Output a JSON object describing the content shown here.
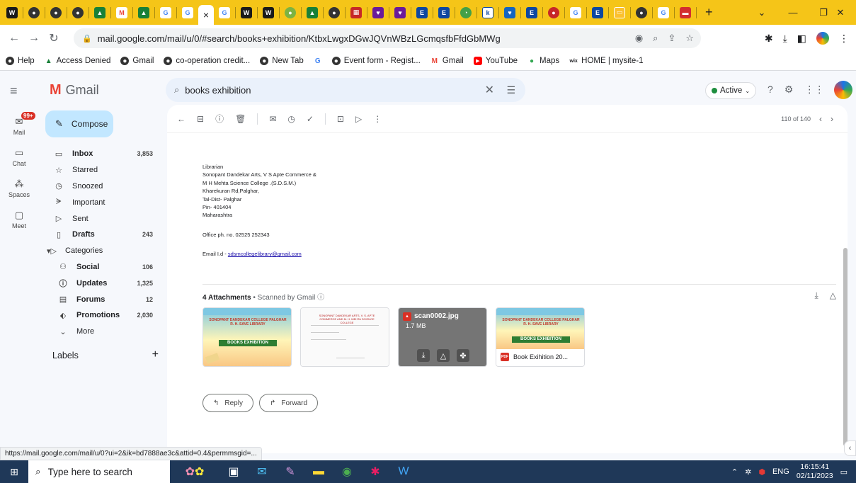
{
  "browser": {
    "active_tab_close": "×",
    "new_tab": "+",
    "url": "mail.google.com/mail/u/0/#search/books+exhibition/KtbxLwgxDGwJQVnWBzLGcmqsfbFfdGbMWg",
    "window_controls": [
      "⌄",
      "—",
      "❐",
      "✕"
    ]
  },
  "bookmarks": [
    {
      "label": "Help"
    },
    {
      "label": "Access Denied"
    },
    {
      "label": "Gmail"
    },
    {
      "label": "co-operation credit..."
    },
    {
      "label": "New Tab"
    },
    {
      "label": "Event form - Regist..."
    },
    {
      "label": "Gmail"
    },
    {
      "label": "YouTube"
    },
    {
      "label": "Maps"
    },
    {
      "label": "HOME | mysite-1"
    }
  ],
  "gmail": {
    "logo_text": "Gmail",
    "search_value": "books exhibition",
    "status": "Active",
    "rail": [
      {
        "label": "Mail",
        "badge": "99+"
      },
      {
        "label": "Chat"
      },
      {
        "label": "Spaces"
      },
      {
        "label": "Meet"
      }
    ],
    "compose_label": "Compose",
    "nav": [
      {
        "label": "Inbox",
        "count": "3,853"
      },
      {
        "label": "Starred",
        "count": ""
      },
      {
        "label": "Snoozed",
        "count": ""
      },
      {
        "label": "Important",
        "count": ""
      },
      {
        "label": "Sent",
        "count": ""
      },
      {
        "label": "Drafts",
        "count": "243"
      },
      {
        "label": "Categories",
        "count": ""
      },
      {
        "label": "Social",
        "count": "106"
      },
      {
        "label": "Updates",
        "count": "1,325"
      },
      {
        "label": "Forums",
        "count": "12"
      },
      {
        "label": "Promotions",
        "count": "2,030"
      },
      {
        "label": "More",
        "count": ""
      }
    ],
    "labels_title": "Labels",
    "labels_add": "+",
    "pager_text": "110 of 140"
  },
  "email": {
    "lines": [
      "Librarian",
      "Sonopant Dandekar Arts, V S Apte Commerce &",
      "M H Mehta Science College .(S.D.S.M.)",
      "Kharekuran Rd,Palghar,",
      "Tal-Dist- Palghar",
      "Pin- 401404",
      "Maharashtra"
    ],
    "office_phone": "Office ph. no. 02525 252343",
    "email_prefix": "Email I.d - ",
    "email_link": "sdsmcollegelibrary@gmail.com",
    "attachments_count": "4 Attachments",
    "scanned_by": " • Scanned by Gmail ⓘ",
    "attachments": [
      {
        "poster_title": "SONOPANT DANDEKAR COLLEGE PALGHAR R. H. SAVE LIBRARY",
        "banner": "BOOKS EXHIBITION"
      },
      {
        "letterhead": "SONOPANT DANDEKAR ARTS, V. S. APTE COMMERCE AND M. H. MEHTA SCIENCE COLLEGE"
      },
      {
        "name": "scan0002.jpg",
        "size": "1.7 MB"
      },
      {
        "poster_title": "SONOPANT DANDEKAR COLLEGE PALGHAR R. H. SAVE LIBRARY",
        "banner": "BOOKS EXHIBITION",
        "pdf_name": "Book Exihition 20...",
        "pdf_label": "PDF"
      }
    ],
    "reply_label": "Reply",
    "forward_label": "Forward"
  },
  "status_url": "https://mail.google.com/mail/u/0?ui=2&ik=bd7888ae3c&attid=0.4&permmsgid=...",
  "taskbar": {
    "search_placeholder": "Type here to search",
    "lang": "ENG",
    "time": "16:15:41",
    "date": "02/11/2023"
  },
  "colors": {
    "tabstrip": "#f5c518",
    "gmail_bg": "#f6f8fc",
    "compose": "#c2e7ff",
    "taskbar": "#1f3858"
  }
}
